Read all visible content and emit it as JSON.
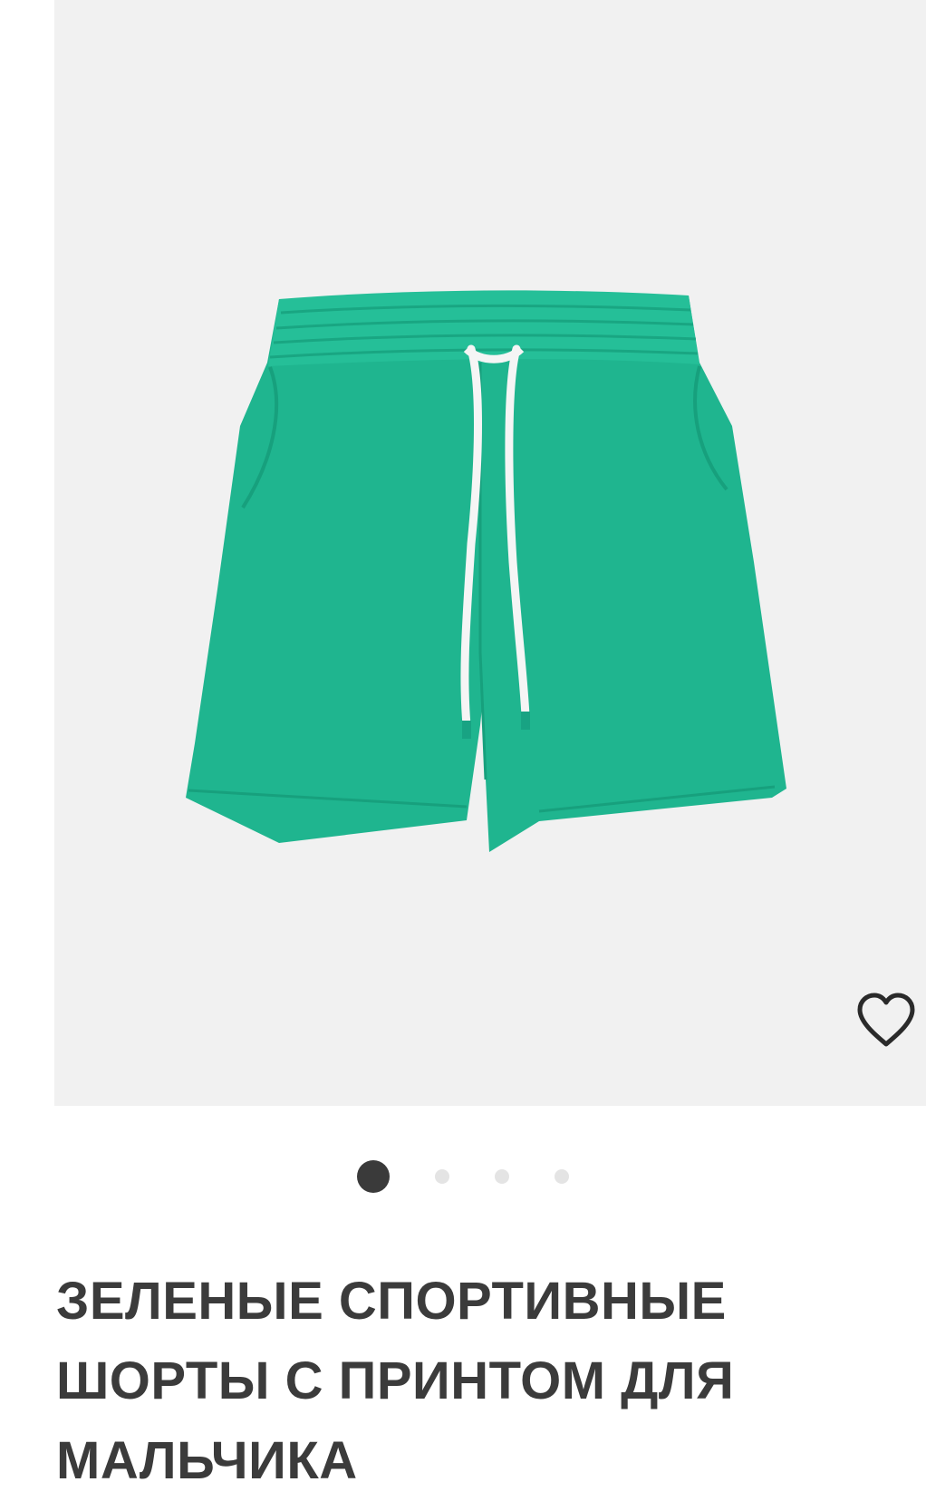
{
  "product": {
    "title": "ЗЕЛЕНЫЕ СПОРТИВНЫЕ ШОРТЫ С ПРИНТОМ ДЛЯ МАЛЬЧИКА",
    "image_subject": "green-shorts",
    "color": "#1fb58f"
  },
  "gallery": {
    "slides_count": 4,
    "active_index": 0,
    "favorite_icon": "heart-outline-icon",
    "background": "#f1f1f1"
  }
}
